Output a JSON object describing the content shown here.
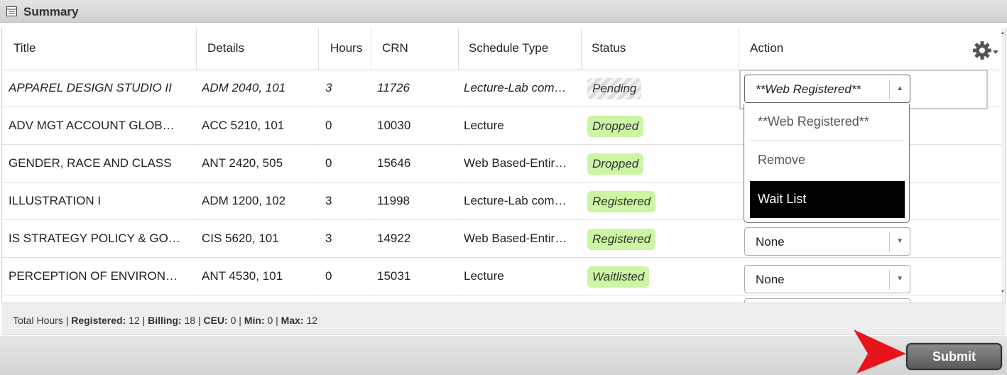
{
  "panel": {
    "title": "Summary",
    "icon": "table-icon"
  },
  "table": {
    "headers": [
      "Title",
      "Details",
      "Hours",
      "CRN",
      "Schedule Type",
      "Status",
      "Action"
    ],
    "rows": [
      {
        "title": "APPAREL DESIGN STUDIO II",
        "details": "ADM 2040, 101",
        "hours": "3",
        "crn": "11726",
        "schedule_type": "Lecture-Lab com…",
        "status": "Pending",
        "action": "**Web Registered**"
      },
      {
        "title": "ADV MGT ACCOUNT GLOB…",
        "details": "ACC 5210, 101",
        "hours": "0",
        "crn": "10030",
        "schedule_type": "Lecture",
        "status": "Dropped",
        "action": ""
      },
      {
        "title": "GENDER, RACE AND CLASS",
        "details": "ANT 2420, 505",
        "hours": "0",
        "crn": "15646",
        "schedule_type": "Web Based-Entir…",
        "status": "Dropped",
        "action": ""
      },
      {
        "title": "ILLUSTRATION I",
        "details": "ADM 1200, 102",
        "hours": "3",
        "crn": "11998",
        "schedule_type": "Lecture-Lab com…",
        "status": "Registered",
        "action": ""
      },
      {
        "title": "IS STRATEGY POLICY & GO…",
        "details": "CIS 5620, 101",
        "hours": "3",
        "crn": "14922",
        "schedule_type": "Web Based-Entir…",
        "status": "Registered",
        "action": "None"
      },
      {
        "title": "PERCEPTION OF ENVIRON…",
        "details": "ANT 4530, 101",
        "hours": "0",
        "crn": "15031",
        "schedule_type": "Lecture",
        "status": "Waitlisted",
        "action": "None"
      }
    ]
  },
  "dropdown": {
    "options": [
      "**Web Registered**",
      "Remove",
      "Wait List"
    ],
    "highlighted": "Wait List"
  },
  "totals": {
    "prefix": "Total Hours | ",
    "registered_label": "Registered:",
    "registered_value": " 12 | ",
    "billing_label": "Billing:",
    "billing_value": " 18 | ",
    "ceu_label": "CEU:",
    "ceu_value": " 0 | ",
    "min_label": "Min:",
    "min_value": " 0 | ",
    "max_label": "Max:",
    "max_value": " 12"
  },
  "footer": {
    "submit_label": "Submit"
  },
  "colors": {
    "status_green": "#ccf5a4",
    "submit_button": "#6b6b6b",
    "annotation_arrow": "#e8141c",
    "dropdown_highlight": "#000000"
  }
}
